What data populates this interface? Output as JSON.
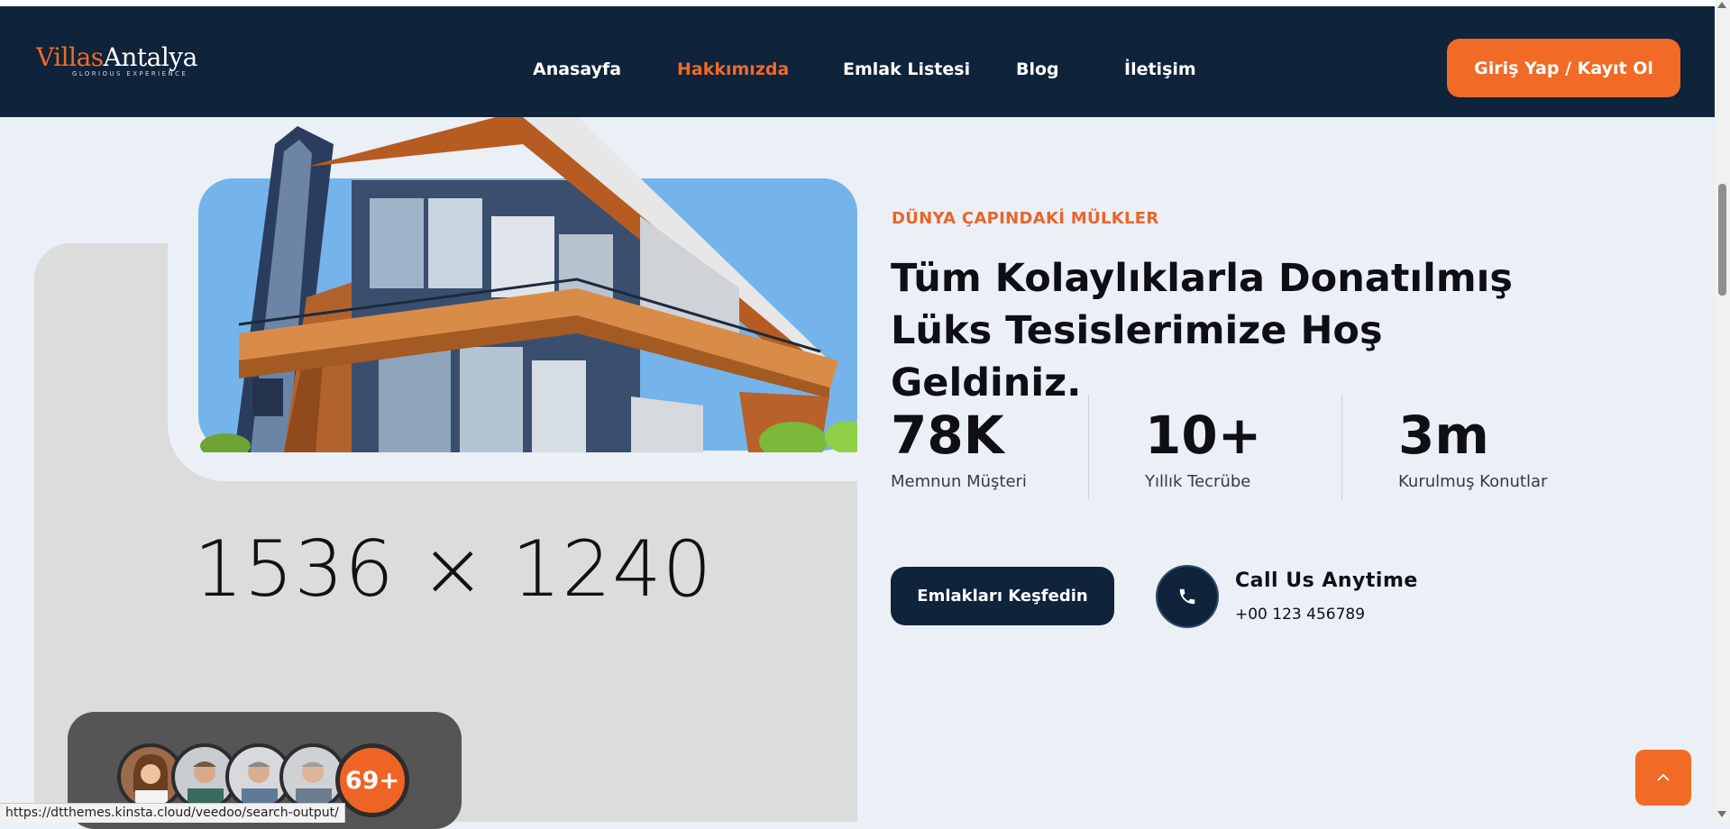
{
  "brand": {
    "logo_part1": "Villas",
    "logo_part2": "Antalya",
    "tagline": "GLORIOUS EXPERIENCE"
  },
  "nav": {
    "items": [
      {
        "label": "Anasayfa"
      },
      {
        "label": "Hakkımızda",
        "active": true
      },
      {
        "label": "Emlak Listesi"
      },
      {
        "label": "Blog"
      },
      {
        "label": "İletişim"
      }
    ],
    "login_label": "Giriş Yap / Kayıt Ol"
  },
  "hero": {
    "placeholder_text": "1536 × 1240",
    "subtitle": "DÜNYA ÇAPINDAKİ MÜLKLER",
    "headline": "Tüm Kolaylıklarla Donatılmış Lüks Tesislerimize Hoş Geldiniz.",
    "stats": [
      {
        "value": "78K",
        "label": "Memnun Müşteri"
      },
      {
        "value": "10+",
        "label": "Yıllık Tecrübe"
      },
      {
        "value": "3m",
        "label": "Kurulmuş Konutlar"
      }
    ],
    "cta_label": "Emlakları Keşfedin",
    "call_title": "Call Us Anytime",
    "call_number": "+00 123 456789"
  },
  "team": {
    "count_label": "69+"
  },
  "status_bar": {
    "url": "https://dtthemes.kinsta.cloud/veedoo/search-output/"
  },
  "colors": {
    "navy": "#0f233b",
    "accent": "#f16a26",
    "background": "#ebeff6"
  },
  "icons": {
    "phone": "phone-icon",
    "back_to_top": "chevron-up-icon"
  }
}
